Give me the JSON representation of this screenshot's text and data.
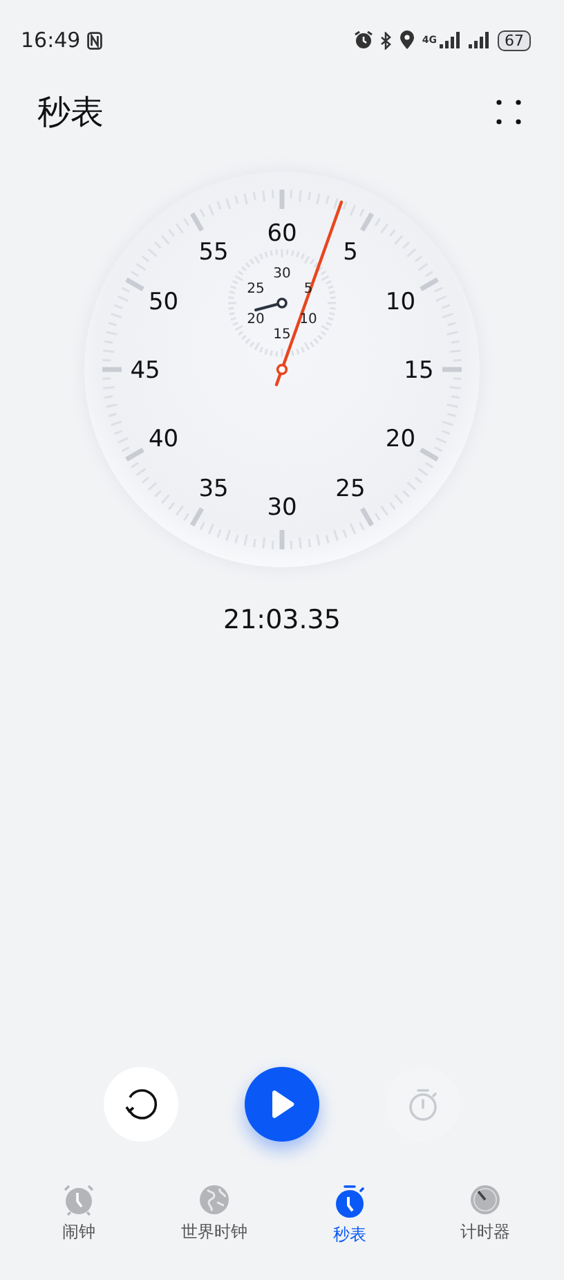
{
  "status_bar": {
    "time": "16:49",
    "network": "4G",
    "battery": "67"
  },
  "header": {
    "title": "秒表"
  },
  "dial": {
    "labels": [
      "60",
      "5",
      "10",
      "15",
      "20",
      "25",
      "30",
      "35",
      "40",
      "45",
      "50",
      "55"
    ],
    "sub_labels": [
      "30",
      "5",
      "10",
      "15",
      "20",
      "25"
    ]
  },
  "reading": "21:03.35",
  "controls": [
    {
      "kind": "reset",
      "disabled": false
    },
    {
      "kind": "start",
      "disabled": false
    },
    {
      "kind": "lap",
      "disabled": true
    }
  ],
  "tabs": [
    {
      "label": "闹钟",
      "selected": false
    },
    {
      "label": "世界时钟",
      "selected": false
    },
    {
      "label": "秒表",
      "selected": true
    },
    {
      "label": "计时器",
      "selected": false
    }
  ]
}
